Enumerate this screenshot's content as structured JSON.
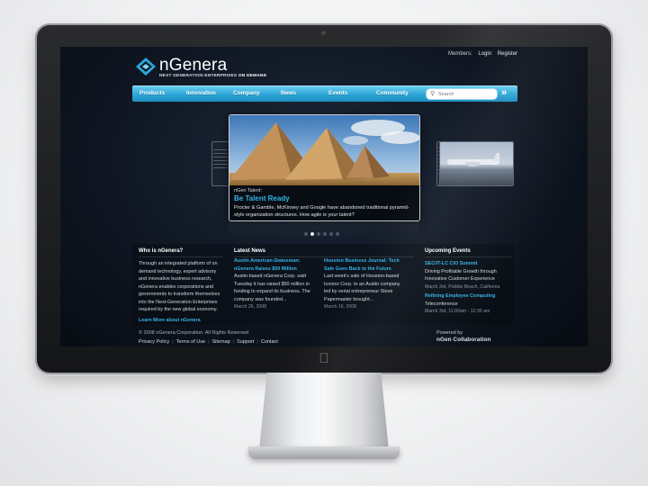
{
  "header": {
    "logo_name": "nGenera",
    "logo_tagline_1": "NEXT GENERATION ENTERPRISES ",
    "logo_tagline_2": "ON DEMAND",
    "members_label": "Members:",
    "login": "Login",
    "register": "Register"
  },
  "nav": {
    "items": [
      "Products",
      "Innovation",
      "Company",
      "News",
      "Events",
      "Community"
    ],
    "search_placeholder": "Search",
    "go_glyph": "»"
  },
  "carousel": {
    "kicker": "nGen Talent:",
    "title": "Be Talent Ready",
    "body": "Procter & Gamble, McKinsey and Google have abandoned traditional pyramid-style organization structures. How agile is your talent?",
    "dot_count": 6,
    "active_dot": 1
  },
  "columns": {
    "who": {
      "heading": "Who is nGenera?",
      "text": "Through an integrated platform of on demand technology, expert advisory and innovative business research, nGenera enables corporations and governments to transform themselves into the Next-Generation Enterprises required by the new global economy.",
      "link": "Learn More about nGenera"
    },
    "news": {
      "heading": "Latest News",
      "items": [
        {
          "title": "Austin American-Statesman: nGenera Raises $50 Million",
          "text": "Austin-based nGenera Corp. said Tuesday it has raised $50 million in funding to expand its business. The company was founded...",
          "date": "March 26, 2008"
        },
        {
          "title": "Houston Business Journal: Tech Sale Goes Back to the Future",
          "text": "Last week's sale of Houston-based Iconixx Corp. to an Austin company led by serial entrepreneur Steve Papermaster brought...",
          "date": "March 16, 2008"
        }
      ]
    },
    "events": {
      "heading": "Upcoming Events",
      "items": [
        {
          "title": "SEC/IT-LC CIO Summit",
          "text": "Driving Profitable Growth through Innovative Customer Experience",
          "date": "March 3rd, Pebble Beach, California"
        },
        {
          "title": "Refining Employee Computing",
          "text": "Teleconference",
          "date": "March 3rd, 11:00am - 12:30 am"
        }
      ]
    }
  },
  "footer": {
    "copyright": "© 2008 nGenera Corporation. All Rights Reserved",
    "links": [
      "Privacy Policy",
      "Terms of Use",
      "Sitemap",
      "Support",
      "Contact"
    ],
    "powered_label": "Powered by",
    "powered_brand": "nGen Collaboration"
  },
  "colors": {
    "accent_blue": "#36b4e6",
    "nav_top": "#6ed0f1",
    "nav_bottom": "#1d8cc0",
    "screen_bg": "#0f1622"
  }
}
